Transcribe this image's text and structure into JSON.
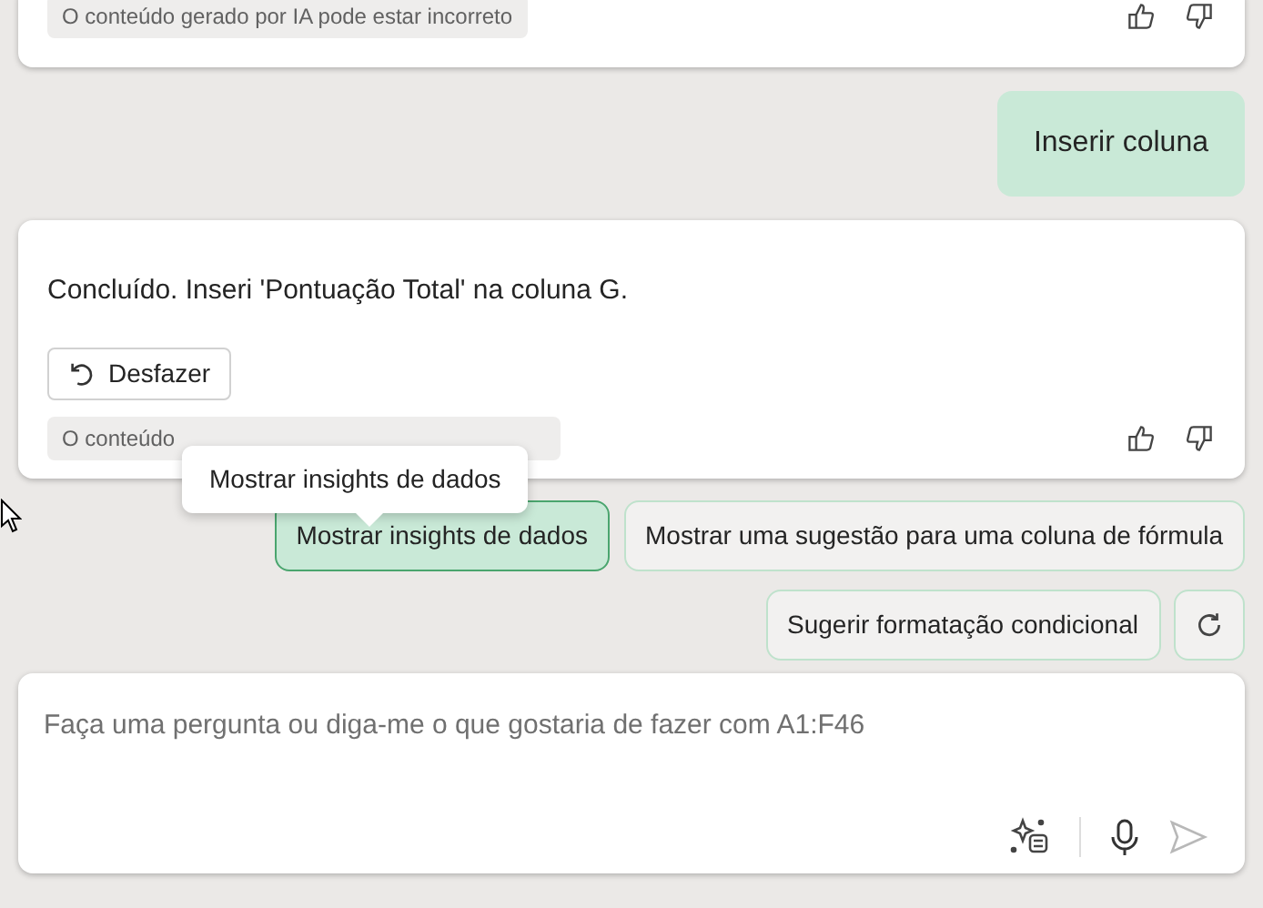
{
  "messages": [
    {
      "kind": "assistant",
      "disclaimer": "O conteúdo gerado por IA pode estar incorreto"
    },
    {
      "kind": "user",
      "text": "Inserir coluna"
    },
    {
      "kind": "assistant",
      "text": "Concluído. Inseri 'Pontuação Total' na coluna G.",
      "undo": "Desfazer",
      "disclaimer": "O conteúdo"
    }
  ],
  "tooltip": "Mostrar insights de dados",
  "suggestions": [
    {
      "label": "Mostrar insights de dados",
      "selected": true
    },
    {
      "label": "Mostrar uma sugestão para uma coluna de fórmula",
      "selected": false
    },
    {
      "label": "Sugerir formatação condicional",
      "selected": false
    }
  ],
  "prompt": {
    "placeholder": "Faça uma pergunta ou diga-me o que gostaria de fazer com A1:F46",
    "send_disabled": true
  }
}
